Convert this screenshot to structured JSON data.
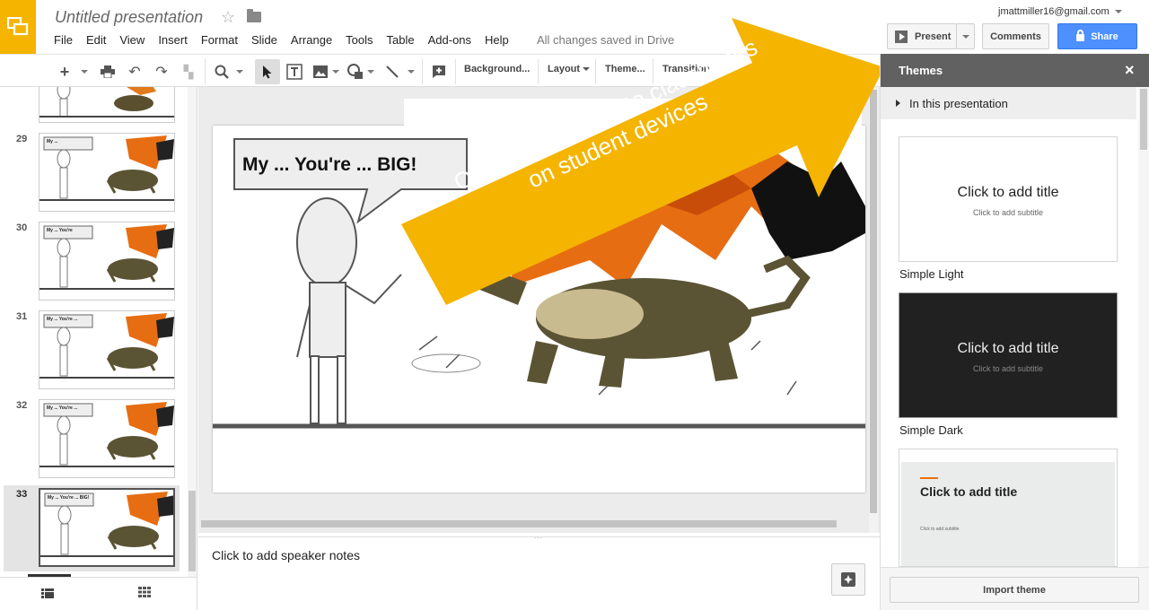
{
  "app": {
    "title": "Untitled presentation",
    "menu": [
      "File",
      "Edit",
      "View",
      "Insert",
      "Format",
      "Slide",
      "Arrange",
      "Tools",
      "Table",
      "Add-ons",
      "Help"
    ],
    "saved_status": "All changes saved in Drive",
    "account_email": "jmattmiller16@gmail.com",
    "present_label": "Present",
    "comments_label": "Comments",
    "share_label": "Share"
  },
  "toolbar": {
    "background_label": "Background...",
    "layout_label": "Layout",
    "theme_label": "Theme...",
    "transition_label": "Transition"
  },
  "filmstrip": {
    "slides": [
      {
        "number": "29",
        "bubble": "My ..."
      },
      {
        "number": "30",
        "bubble": "My ... You're"
      },
      {
        "number": "31",
        "bubble": "My ... You're ..."
      },
      {
        "number": "32",
        "bubble": "My ... You're ..."
      },
      {
        "number": "33",
        "bubble": "My ... You're ... BIG!"
      }
    ],
    "selected": "33"
  },
  "slide": {
    "speech_bubble": "My ... You're ... BIG!"
  },
  "annotation": {
    "line1": "Option 1: Present to classmates",
    "line2": "on student devices"
  },
  "notes": {
    "placeholder": "Click to add speaker notes"
  },
  "themes_panel": {
    "title": "Themes",
    "section": "In this presentation",
    "themes": [
      {
        "name": "Simple Light",
        "preview_title": "Click to add title",
        "preview_subtitle": "Click to add subtitle"
      },
      {
        "name": "Simple Dark",
        "preview_title": "Click to add title",
        "preview_subtitle": "Click to add subtitle"
      },
      {
        "name": "",
        "preview_title": "Click to add title",
        "preview_subtitle": "Click to add subtitle"
      }
    ],
    "import_label": "Import theme"
  },
  "colors": {
    "accent_yellow": "#f4b400",
    "share_blue": "#4d90fe",
    "panel_header": "#616161"
  }
}
